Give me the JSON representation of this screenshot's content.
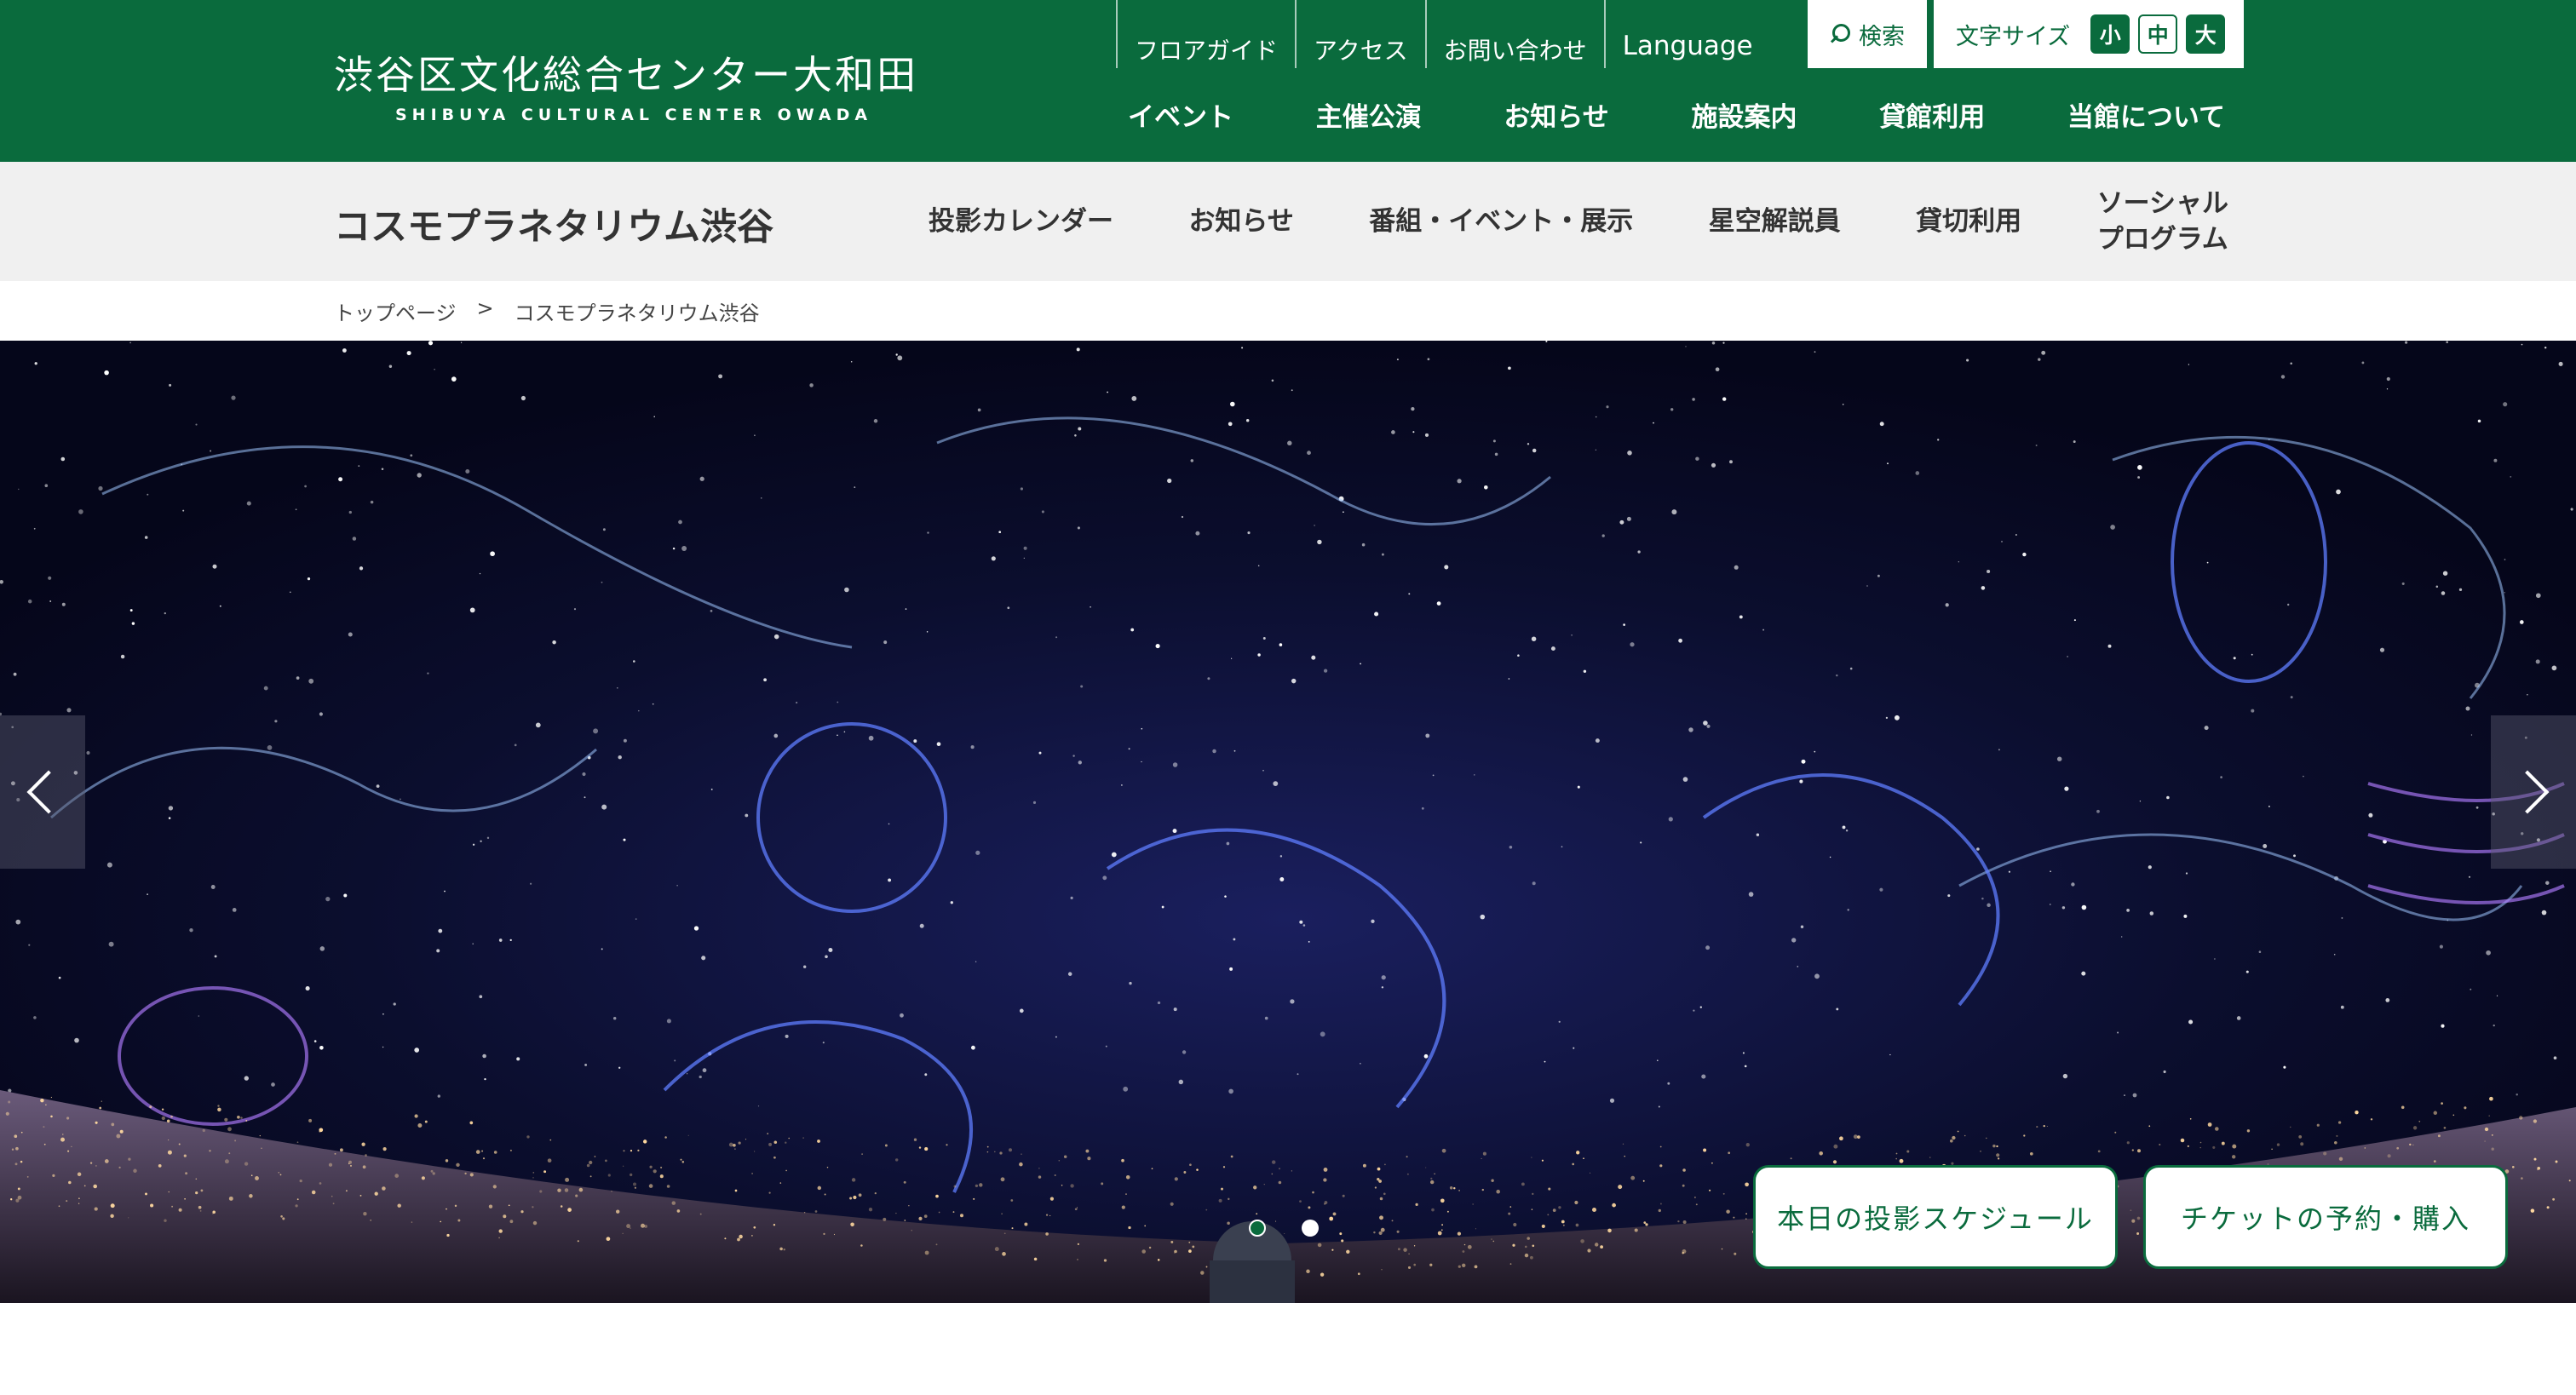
{
  "header": {
    "logo_jp": "渋谷区文化総合センター大和田",
    "logo_en": "SHIBUYA CULTURAL CENTER OWADA",
    "util_nav": [
      "フロアガイド",
      "アクセス",
      "お問い合わせ",
      "Language"
    ],
    "search_label": "検索",
    "fontsize_label": "文字サイズ",
    "fontsize_options": [
      "小",
      "中",
      "大"
    ],
    "main_nav": [
      "イベント",
      "主催公演",
      "お知らせ",
      "施設案内",
      "貸館利用",
      "当館について"
    ]
  },
  "subnav": {
    "title": "コスモプラネタリウム渋谷",
    "items": [
      "投影カレンダー",
      "お知らせ",
      "番組・イベント・展示",
      "星空解説員",
      "貸切利用",
      "ソーシャル\nプログラム"
    ]
  },
  "breadcrumb": {
    "home": "トップページ",
    "separator": ">",
    "current": "コスモプラネタリウム渋谷"
  },
  "hero": {
    "cta_schedule": "本日の投影スケジュール",
    "cta_ticket": "チケットの予約・購入",
    "slide_count": 2,
    "active_slide": 1
  },
  "colors": {
    "brand_green": "#0a6b3d",
    "subnav_bg": "#f0f0f0",
    "sky": "#06081c"
  }
}
